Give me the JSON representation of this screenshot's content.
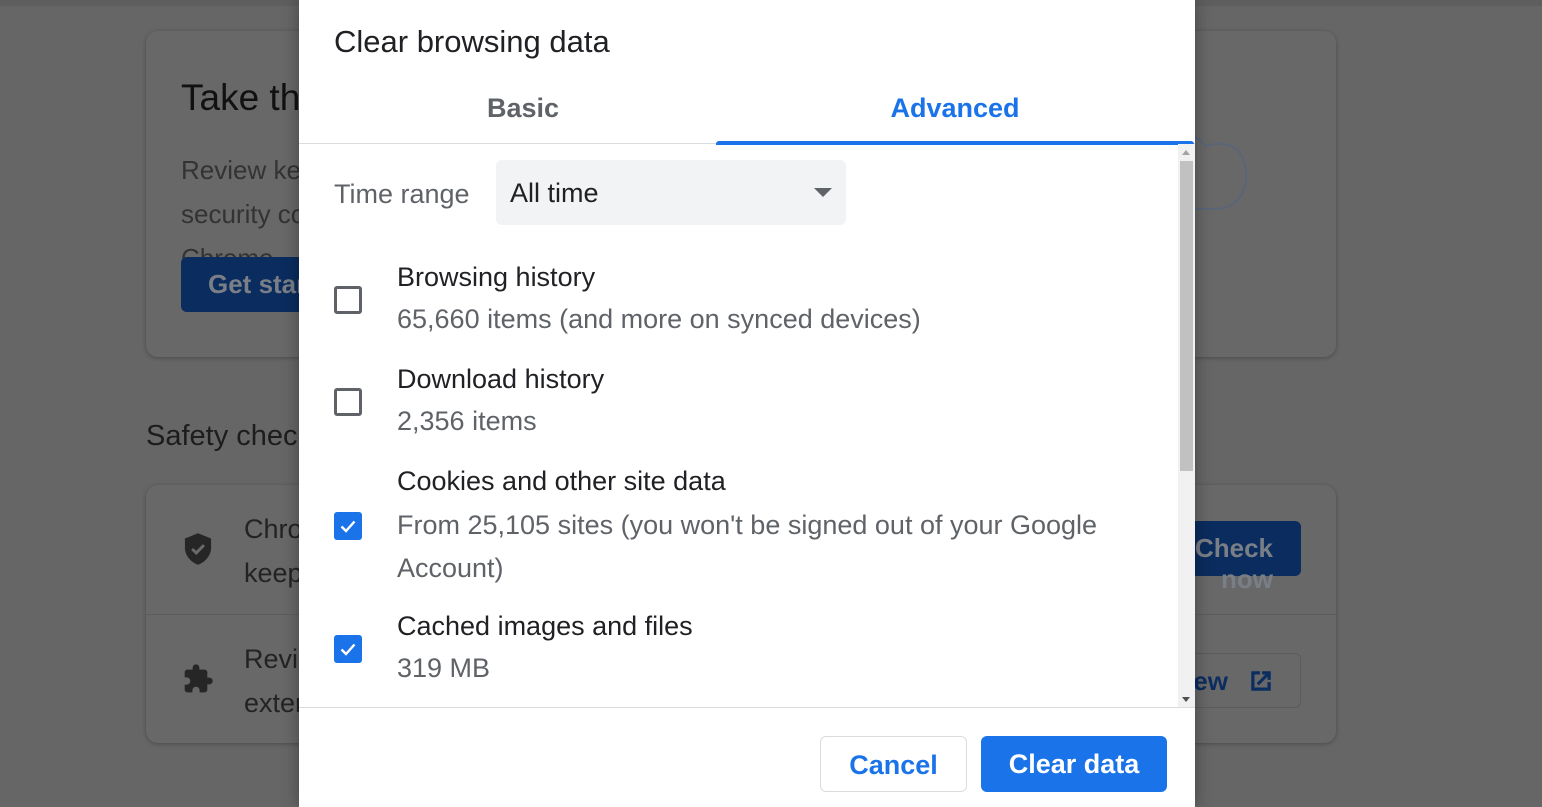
{
  "background_page": {
    "privacy_card": {
      "title": "Take the privacy guide",
      "description": "Review key privacy and security controls in Chrome",
      "button_label": "Get started"
    },
    "safety_check": {
      "heading": "Safety check",
      "rows": [
        {
          "icon": "shield-check-icon",
          "text": "Chrome can help keep you safe from data breaches, bad extensions, and more",
          "button_label": "Check now"
        },
        {
          "icon": "puzzle-extension-icon",
          "text": "Review extensions from the Chrome Web Store",
          "button_label": "Review"
        }
      ]
    }
  },
  "dialog": {
    "title": "Clear browsing data",
    "tabs": [
      {
        "label": "Basic",
        "active": false
      },
      {
        "label": "Advanced",
        "active": true
      }
    ],
    "time_range": {
      "label": "Time range",
      "selected": "All time"
    },
    "items": [
      {
        "label": "Browsing history",
        "description": "65,660 items (and more on synced devices)",
        "checked": false
      },
      {
        "label": "Download history",
        "description": "2,356 items",
        "checked": false
      },
      {
        "label": "Cookies and other site data",
        "description": "From 25,105 sites (you won't be signed out of your Google Account)",
        "checked": true
      },
      {
        "label": "Cached images and files",
        "description": "319 MB",
        "checked": true
      }
    ],
    "buttons": {
      "cancel": "Cancel",
      "confirm": "Clear data"
    }
  },
  "colors": {
    "accent": "#1a73e8",
    "scrim": "#666666"
  }
}
